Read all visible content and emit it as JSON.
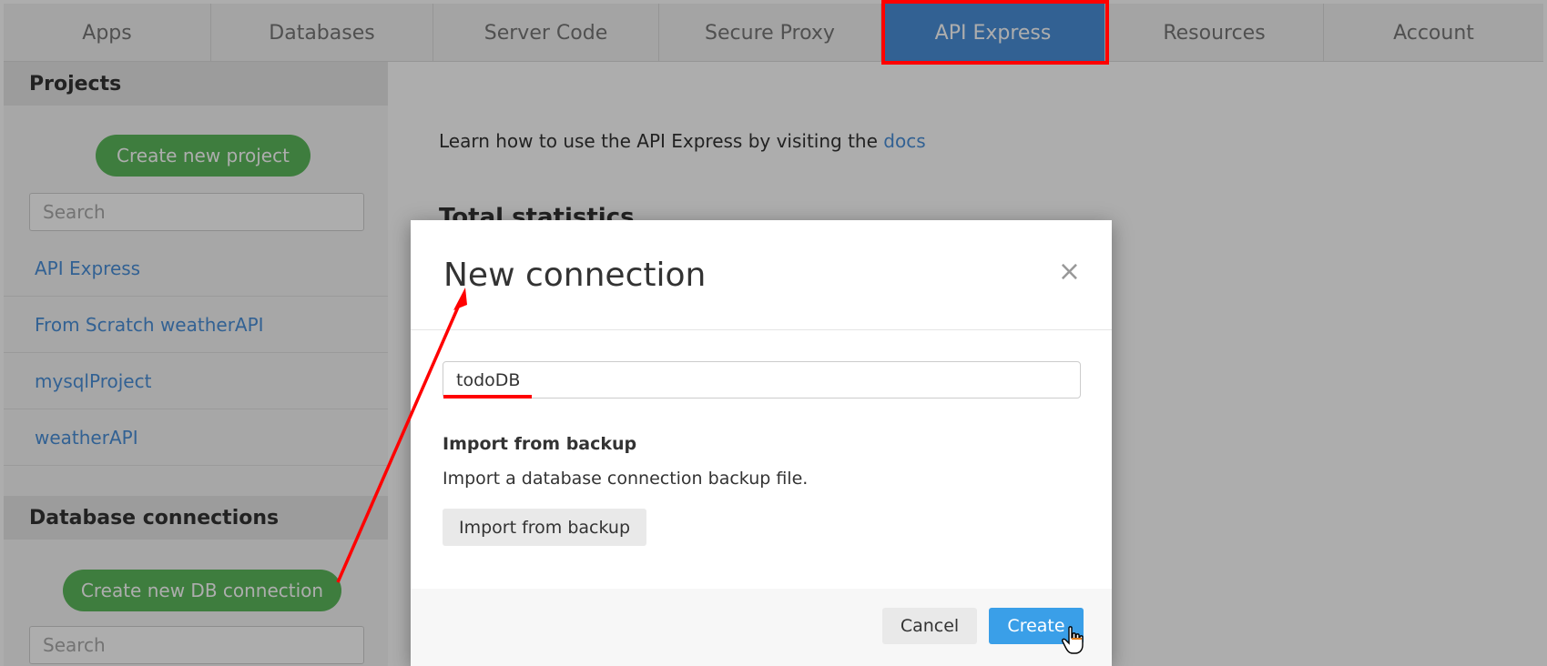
{
  "tabs": [
    "Apps",
    "Databases",
    "Server Code",
    "Secure Proxy",
    "API Express",
    "Resources",
    "Account"
  ],
  "active_tab": "API Express",
  "sidebar": {
    "projects_heading": "Projects",
    "create_project_label": "Create new project",
    "search_placeholder": "Search",
    "projects": [
      "API Express",
      "From Scratch weatherAPI",
      "mysqlProject",
      "weatherAPI"
    ],
    "db_heading": "Database connections",
    "create_db_label": "Create new DB connection",
    "db_search_placeholder": "Search"
  },
  "main": {
    "intro_text": "Learn how to use the API Express by visiting the",
    "docs_link": "docs",
    "stats_heading": "Total statistics"
  },
  "modal": {
    "title": "New connection",
    "close_glyph": "×",
    "name_value": "todoDB",
    "import_heading": "Import from backup",
    "import_desc": "Import a database connection backup file.",
    "import_button": "Import from backup",
    "cancel_button": "Cancel",
    "create_button": "Create"
  },
  "colors": {
    "accent_blue": "#4a90d9",
    "primary_button": "#3a9fe8",
    "green_button": "#5cb85c",
    "annotation_red": "#ff0000"
  }
}
